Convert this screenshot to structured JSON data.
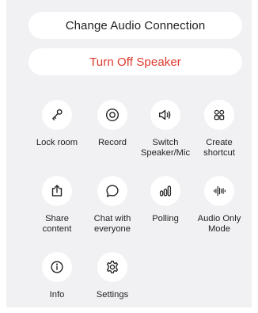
{
  "actions": {
    "change_audio": "Change Audio Connection",
    "turn_off_speaker": "Turn Off Speaker"
  },
  "grid": [
    {
      "label": "Lock room",
      "icon": "key-icon"
    },
    {
      "label": "Record",
      "icon": "record-icon"
    },
    {
      "label": "Switch\nSpeaker/Mic",
      "icon": "speaker-icon"
    },
    {
      "label": "Create\nshortcut",
      "icon": "grid-icon"
    },
    {
      "label": "Share\ncontent",
      "icon": "share-icon"
    },
    {
      "label": "Chat with\neveryone",
      "icon": "chat-bubble-icon"
    },
    {
      "label": "Polling",
      "icon": "polling-icon"
    },
    {
      "label": "Audio Only\nMode",
      "icon": "audio-waveform-icon"
    },
    {
      "label": "Info",
      "icon": "info-icon"
    },
    {
      "label": "Settings",
      "icon": "settings-gear-icon"
    }
  ],
  "colors": {
    "panel_background": "#f1f1f3",
    "destructive_text": "#e0382d",
    "icon_stroke": "#222222"
  }
}
